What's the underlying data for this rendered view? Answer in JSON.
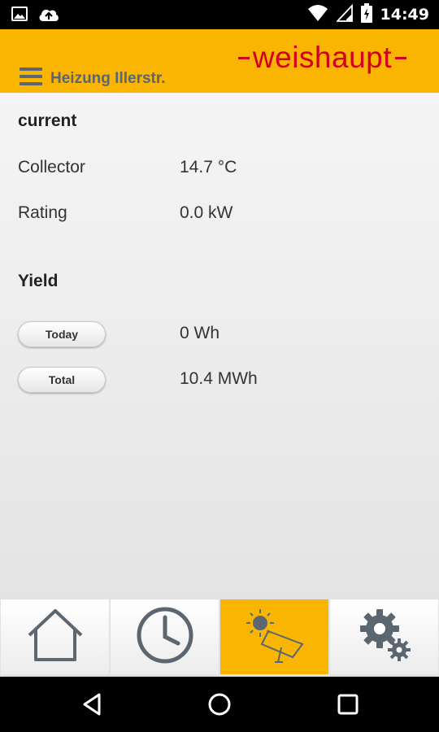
{
  "status_bar": {
    "time": "14:49",
    "left_icons": [
      "image-icon",
      "cloud-upload-icon"
    ],
    "right_icons": [
      "wifi-icon",
      "signal-icon",
      "battery-charging-icon"
    ]
  },
  "header": {
    "title": "Heizung Illerstr.",
    "logo": "weishaupt",
    "background_color": "#f9b500",
    "logo_color": "#d2001e"
  },
  "current": {
    "heading": "current",
    "rows": [
      {
        "label": "Collector",
        "value": "14.7 °C"
      },
      {
        "label": "Rating",
        "value": "0.0 kW"
      }
    ]
  },
  "yield": {
    "heading": "Yield",
    "rows": [
      {
        "label": "Today",
        "value": "0 Wh"
      },
      {
        "label": "Total",
        "value": "10.4 MWh"
      }
    ]
  },
  "tabs": [
    {
      "icon": "home-icon",
      "active": false
    },
    {
      "icon": "clock-icon",
      "active": false
    },
    {
      "icon": "solar-collector-icon",
      "active": true
    },
    {
      "icon": "settings-gears-icon",
      "active": false
    }
  ],
  "nav": {
    "icons": [
      "back-icon",
      "home-circle-icon",
      "recents-icon"
    ]
  }
}
